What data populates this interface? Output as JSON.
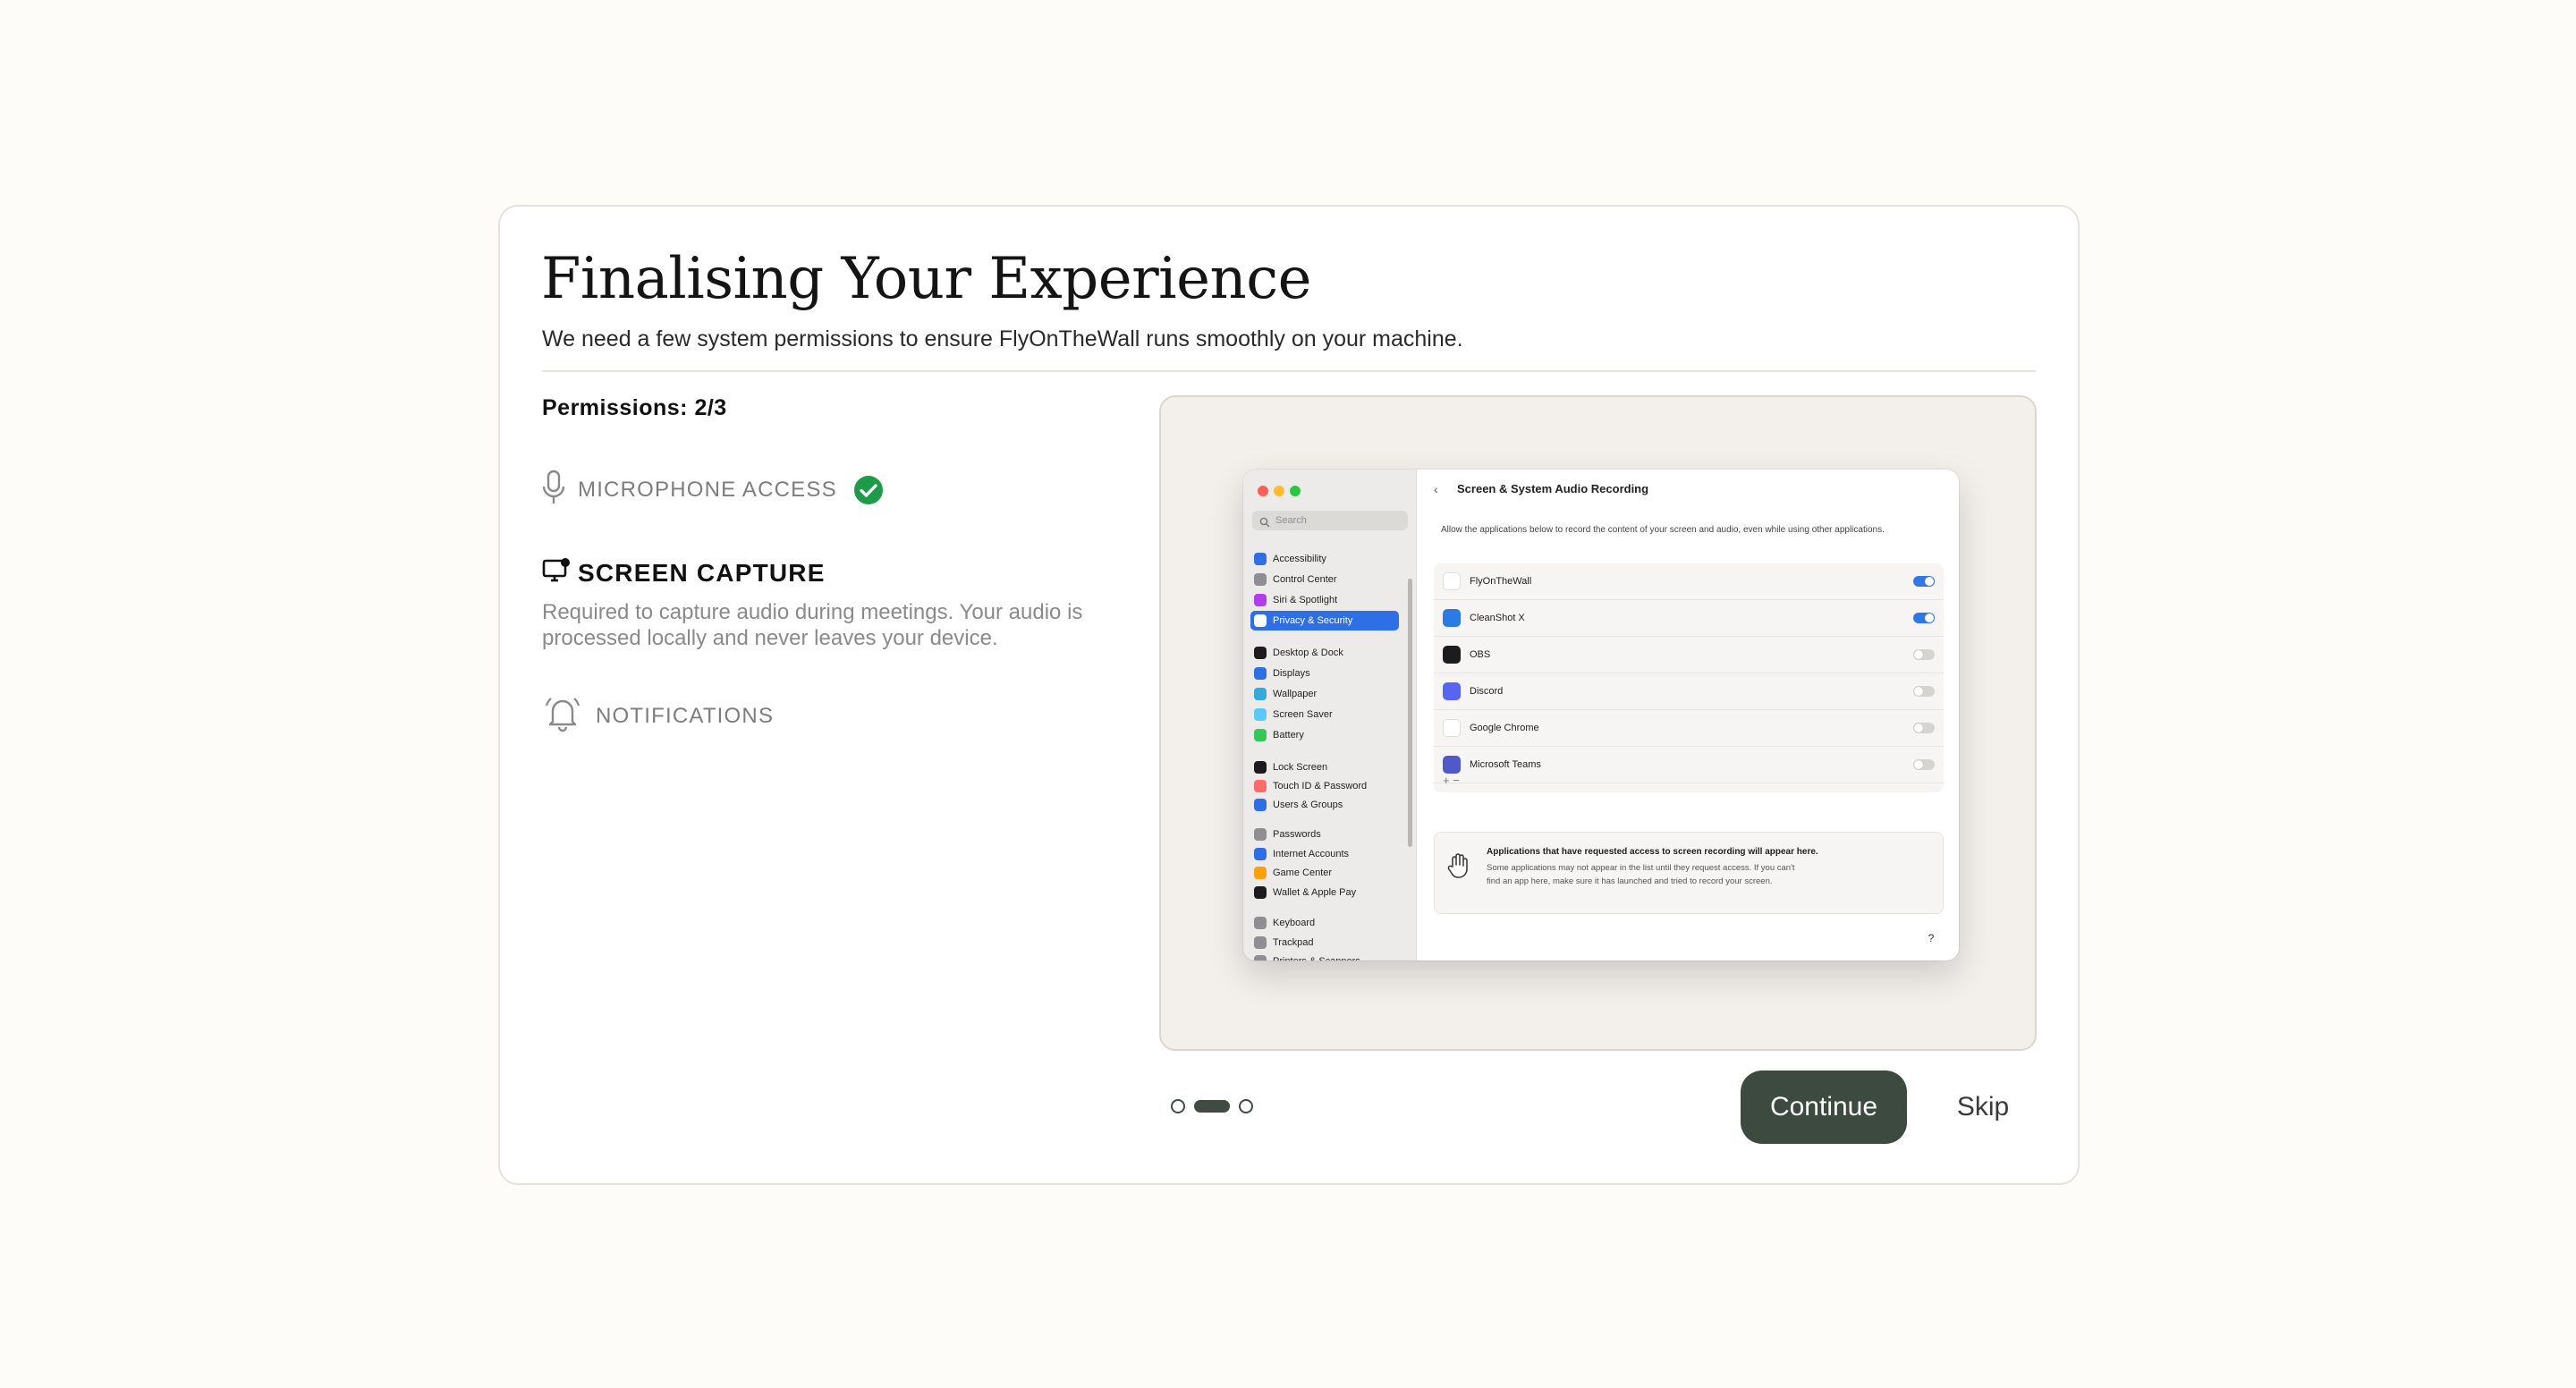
{
  "header": {
    "title": "Finalising Your Experience",
    "subtitle": "We need a few system permissions to ensure FlyOnTheWall runs smoothly on your machine."
  },
  "permissions": {
    "count_label": "Permissions: 2/3",
    "items": [
      {
        "label": "MICROPHONE ACCESS",
        "status": "granted",
        "icon": "microphone-icon"
      },
      {
        "label": "SCREEN CAPTURE",
        "status": "active",
        "icon": "screen-capture-icon",
        "description": "Required to capture audio during meetings. Your audio is processed locally and never leaves your device."
      },
      {
        "label": "NOTIFICATIONS",
        "status": "pending",
        "icon": "bell-icon"
      }
    ]
  },
  "preview": {
    "search_placeholder": "Search",
    "sidebar": [
      {
        "label": "Accessibility",
        "color": "#2f6fe6"
      },
      {
        "label": "Control Center",
        "color": "#8e8e93"
      },
      {
        "label": "Siri & Spotlight",
        "color": "#b23cf0"
      },
      {
        "label": "Privacy & Security",
        "color": "#2f6fe6",
        "selected": true
      },
      {
        "label": "Desktop & Dock",
        "color": "#1c1c1e"
      },
      {
        "label": "Displays",
        "color": "#2f6fe6"
      },
      {
        "label": "Wallpaper",
        "color": "#34aadc"
      },
      {
        "label": "Screen Saver",
        "color": "#5ac8fa"
      },
      {
        "label": "Battery",
        "color": "#34c759"
      },
      {
        "label": "Lock Screen",
        "color": "#1c1c1e"
      },
      {
        "label": "Touch ID & Password",
        "color": "#ff6b6b"
      },
      {
        "label": "Users & Groups",
        "color": "#2f6fe6"
      },
      {
        "label": "Passwords",
        "color": "#8e8e93"
      },
      {
        "label": "Internet Accounts",
        "color": "#2f6fe6"
      },
      {
        "label": "Game Center",
        "color": "#ff9f0a"
      },
      {
        "label": "Wallet & Apple Pay",
        "color": "#1c1c1e"
      },
      {
        "label": "Keyboard",
        "color": "#8e8e93"
      },
      {
        "label": "Trackpad",
        "color": "#8e8e93"
      },
      {
        "label": "Printers & Scanners",
        "color": "#8e8e93"
      }
    ],
    "panel_title": "Screen & System Audio Recording",
    "panel_desc": "Allow the applications below to record the content of your screen and audio, even while using other applications.",
    "apps": [
      {
        "name": "FlyOnTheWall",
        "enabled": true,
        "color": "#ffffff"
      },
      {
        "name": "CleanShot X",
        "enabled": true,
        "color": "#2c7be5"
      },
      {
        "name": "OBS",
        "enabled": false,
        "color": "#1c1c1e"
      },
      {
        "name": "Discord",
        "enabled": false,
        "color": "#5865f2"
      },
      {
        "name": "Google Chrome",
        "enabled": false,
        "color": "#ffffff"
      },
      {
        "name": "Microsoft Teams",
        "enabled": false,
        "color": "#5059c9"
      }
    ],
    "add_remove": "+  −",
    "info_title": "Applications that have requested access to screen recording will appear here.",
    "info_text": "Some applications may not appear in the list until they request access. If you can't find an app here, make sure it has launched and tried to record your screen.",
    "help": "?"
  },
  "footer": {
    "step_current": 2,
    "step_total": 3,
    "continue_label": "Continue",
    "skip_label": "Skip"
  }
}
